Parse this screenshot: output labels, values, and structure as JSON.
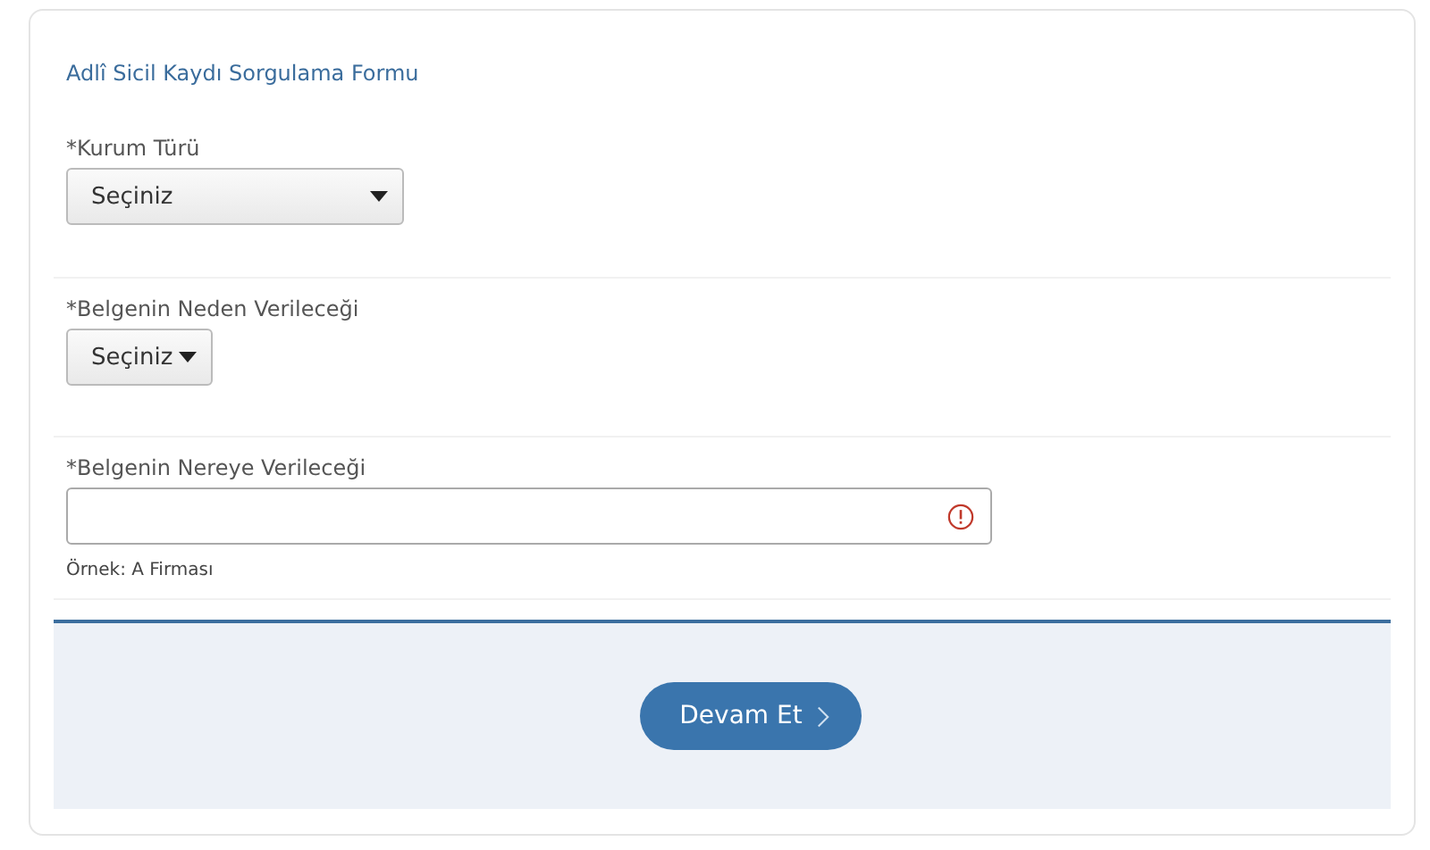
{
  "form": {
    "title": "Adlî Sicil Kaydı Sorgulama Formu",
    "fields": [
      {
        "kind": "select",
        "label": "*Kurum Türü",
        "value": "Seçiniz",
        "wide": true
      },
      {
        "kind": "select",
        "label": "*Belgenin Neden Verileceği",
        "value": "Seçiniz",
        "wide": false
      },
      {
        "kind": "text",
        "label": "*Belgenin Nereye Verileceği",
        "error": true,
        "hint": "Örnek: A Firması"
      }
    ]
  },
  "footer": {
    "button": "Devam Et"
  }
}
